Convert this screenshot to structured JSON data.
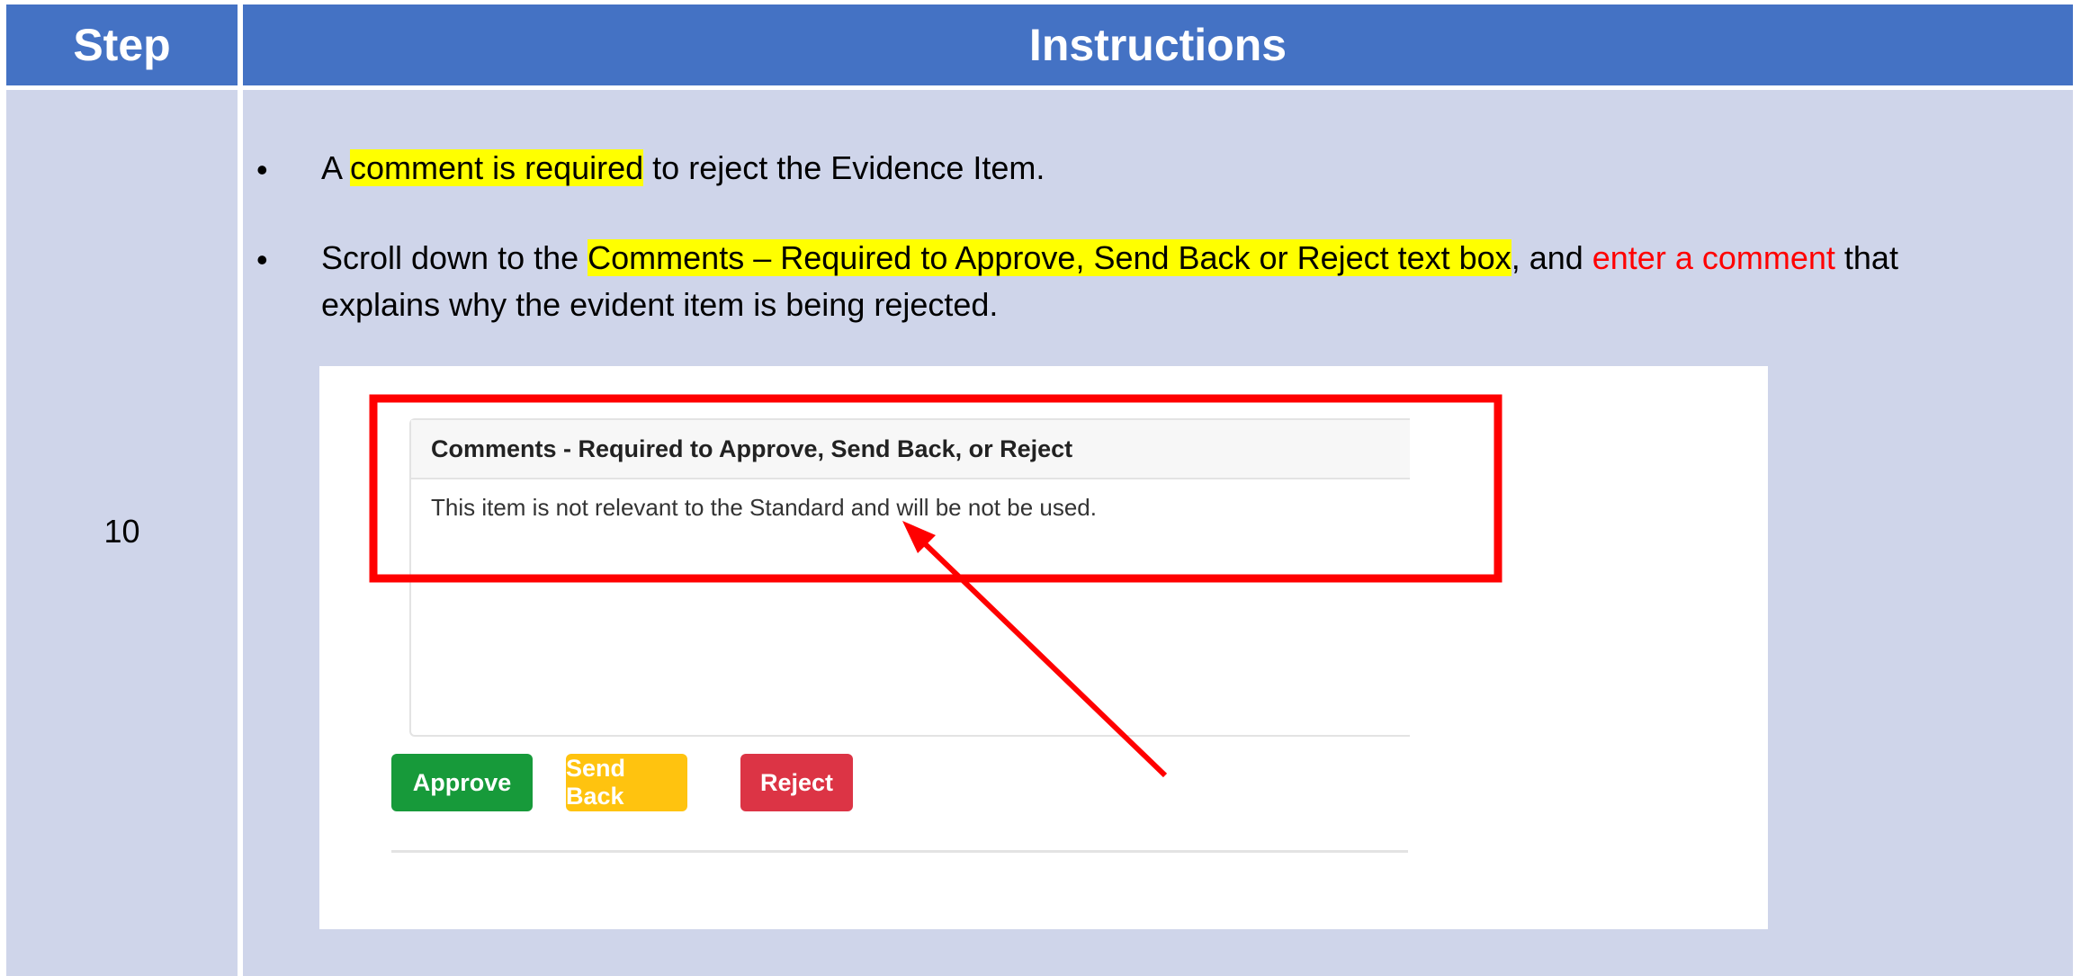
{
  "header": {
    "step": "Step",
    "instructions": "Instructions"
  },
  "step_number": "10",
  "bullets": [
    {
      "marker": "•",
      "parts": [
        "A ",
        "comment is required",
        " to reject the Evidence Item."
      ]
    },
    {
      "marker": "•",
      "parts": [
        "Scroll down to the ",
        "Comments – Required to Approve, Send Back or Reject text box",
        ", and ",
        "enter a comment",
        " that"
      ],
      "line2": "explains why the evident item is being rejected."
    }
  ],
  "screenshot": {
    "panel_title": "Comments - Required to Approve, Send Back, or Reject",
    "comment_text": "This item is not relevant to the Standard and will be not be used.",
    "buttons": {
      "approve": "Approve",
      "send_back": "Send Back",
      "reject": "Reject"
    }
  },
  "colors": {
    "header_bg": "#4472c4",
    "cell_bg": "#cfd5ea",
    "highlight": "#ffff00",
    "annotation_red": "#ff0000",
    "approve": "#179a3a",
    "send_back": "#ffc30f",
    "reject": "#dc3445"
  }
}
